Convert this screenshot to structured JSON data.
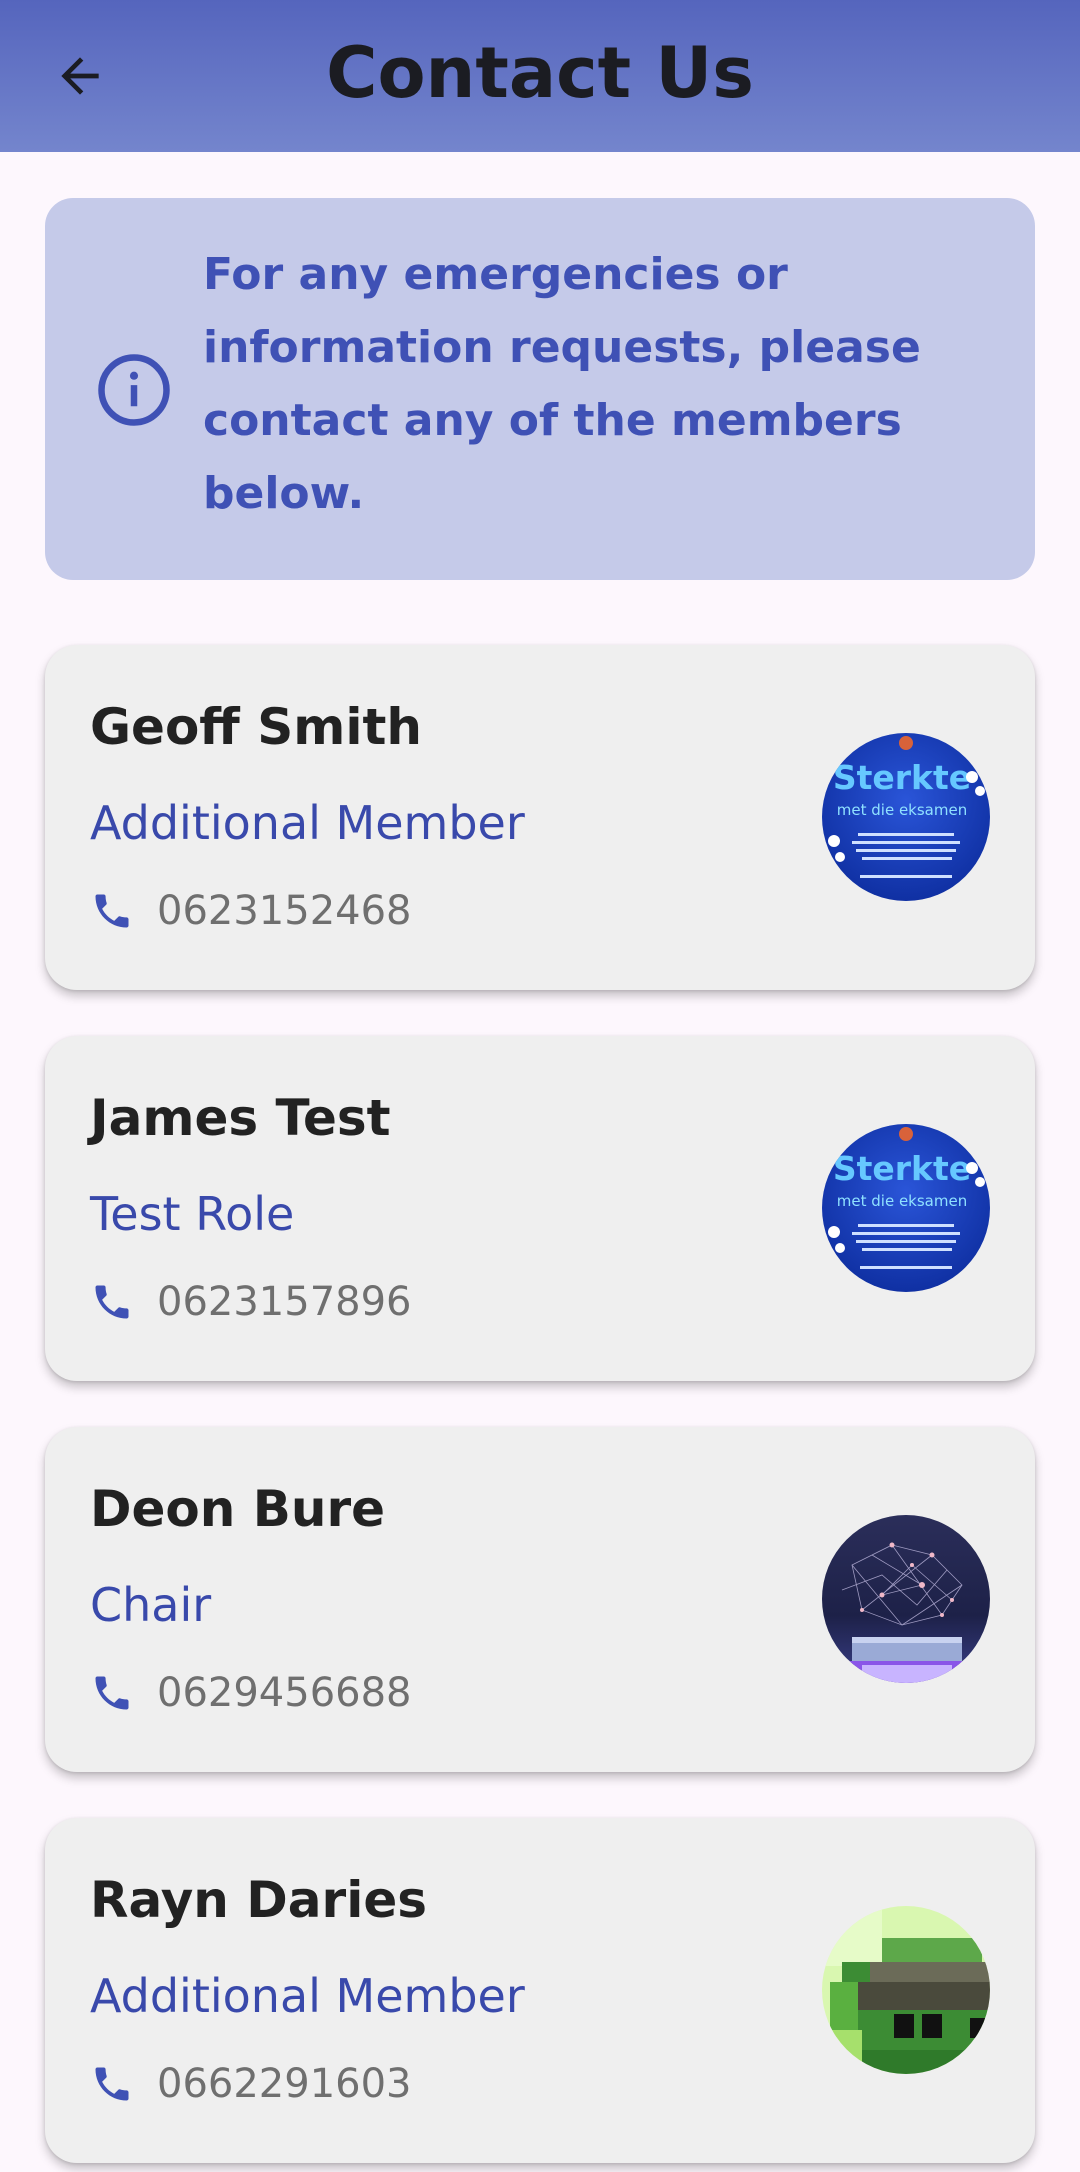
{
  "appbar": {
    "title": "Contact Us",
    "back_icon": "arrow-back-icon"
  },
  "info_banner": {
    "icon": "info-icon",
    "text": "For any emergencies or information requests, please contact any of the members below."
  },
  "colors": {
    "appbar_top": "#5565bd",
    "appbar_bottom": "#7485cd",
    "banner_bg": "#c5cae9",
    "accent": "#3f51b5",
    "card_bg": "#efefef"
  },
  "contacts": [
    {
      "name": "Geoff Smith",
      "role": "Additional Member",
      "phone": "0623152468",
      "avatar": "poster-avatar",
      "avatar_text": [
        "Sterkte",
        "met die eksamen"
      ]
    },
    {
      "name": "James Test",
      "role": "Test Role",
      "phone": "0623157896",
      "avatar": "poster-avatar",
      "avatar_text": [
        "Sterkte",
        "met die eksamen"
      ]
    },
    {
      "name": "Deon Bure",
      "role": "Chair",
      "phone": "0629456688",
      "avatar": "network-stage-avatar"
    },
    {
      "name": "Rayn Daries",
      "role": "Additional Member",
      "phone": "0662291603",
      "avatar": "pixel-character-avatar"
    }
  ]
}
